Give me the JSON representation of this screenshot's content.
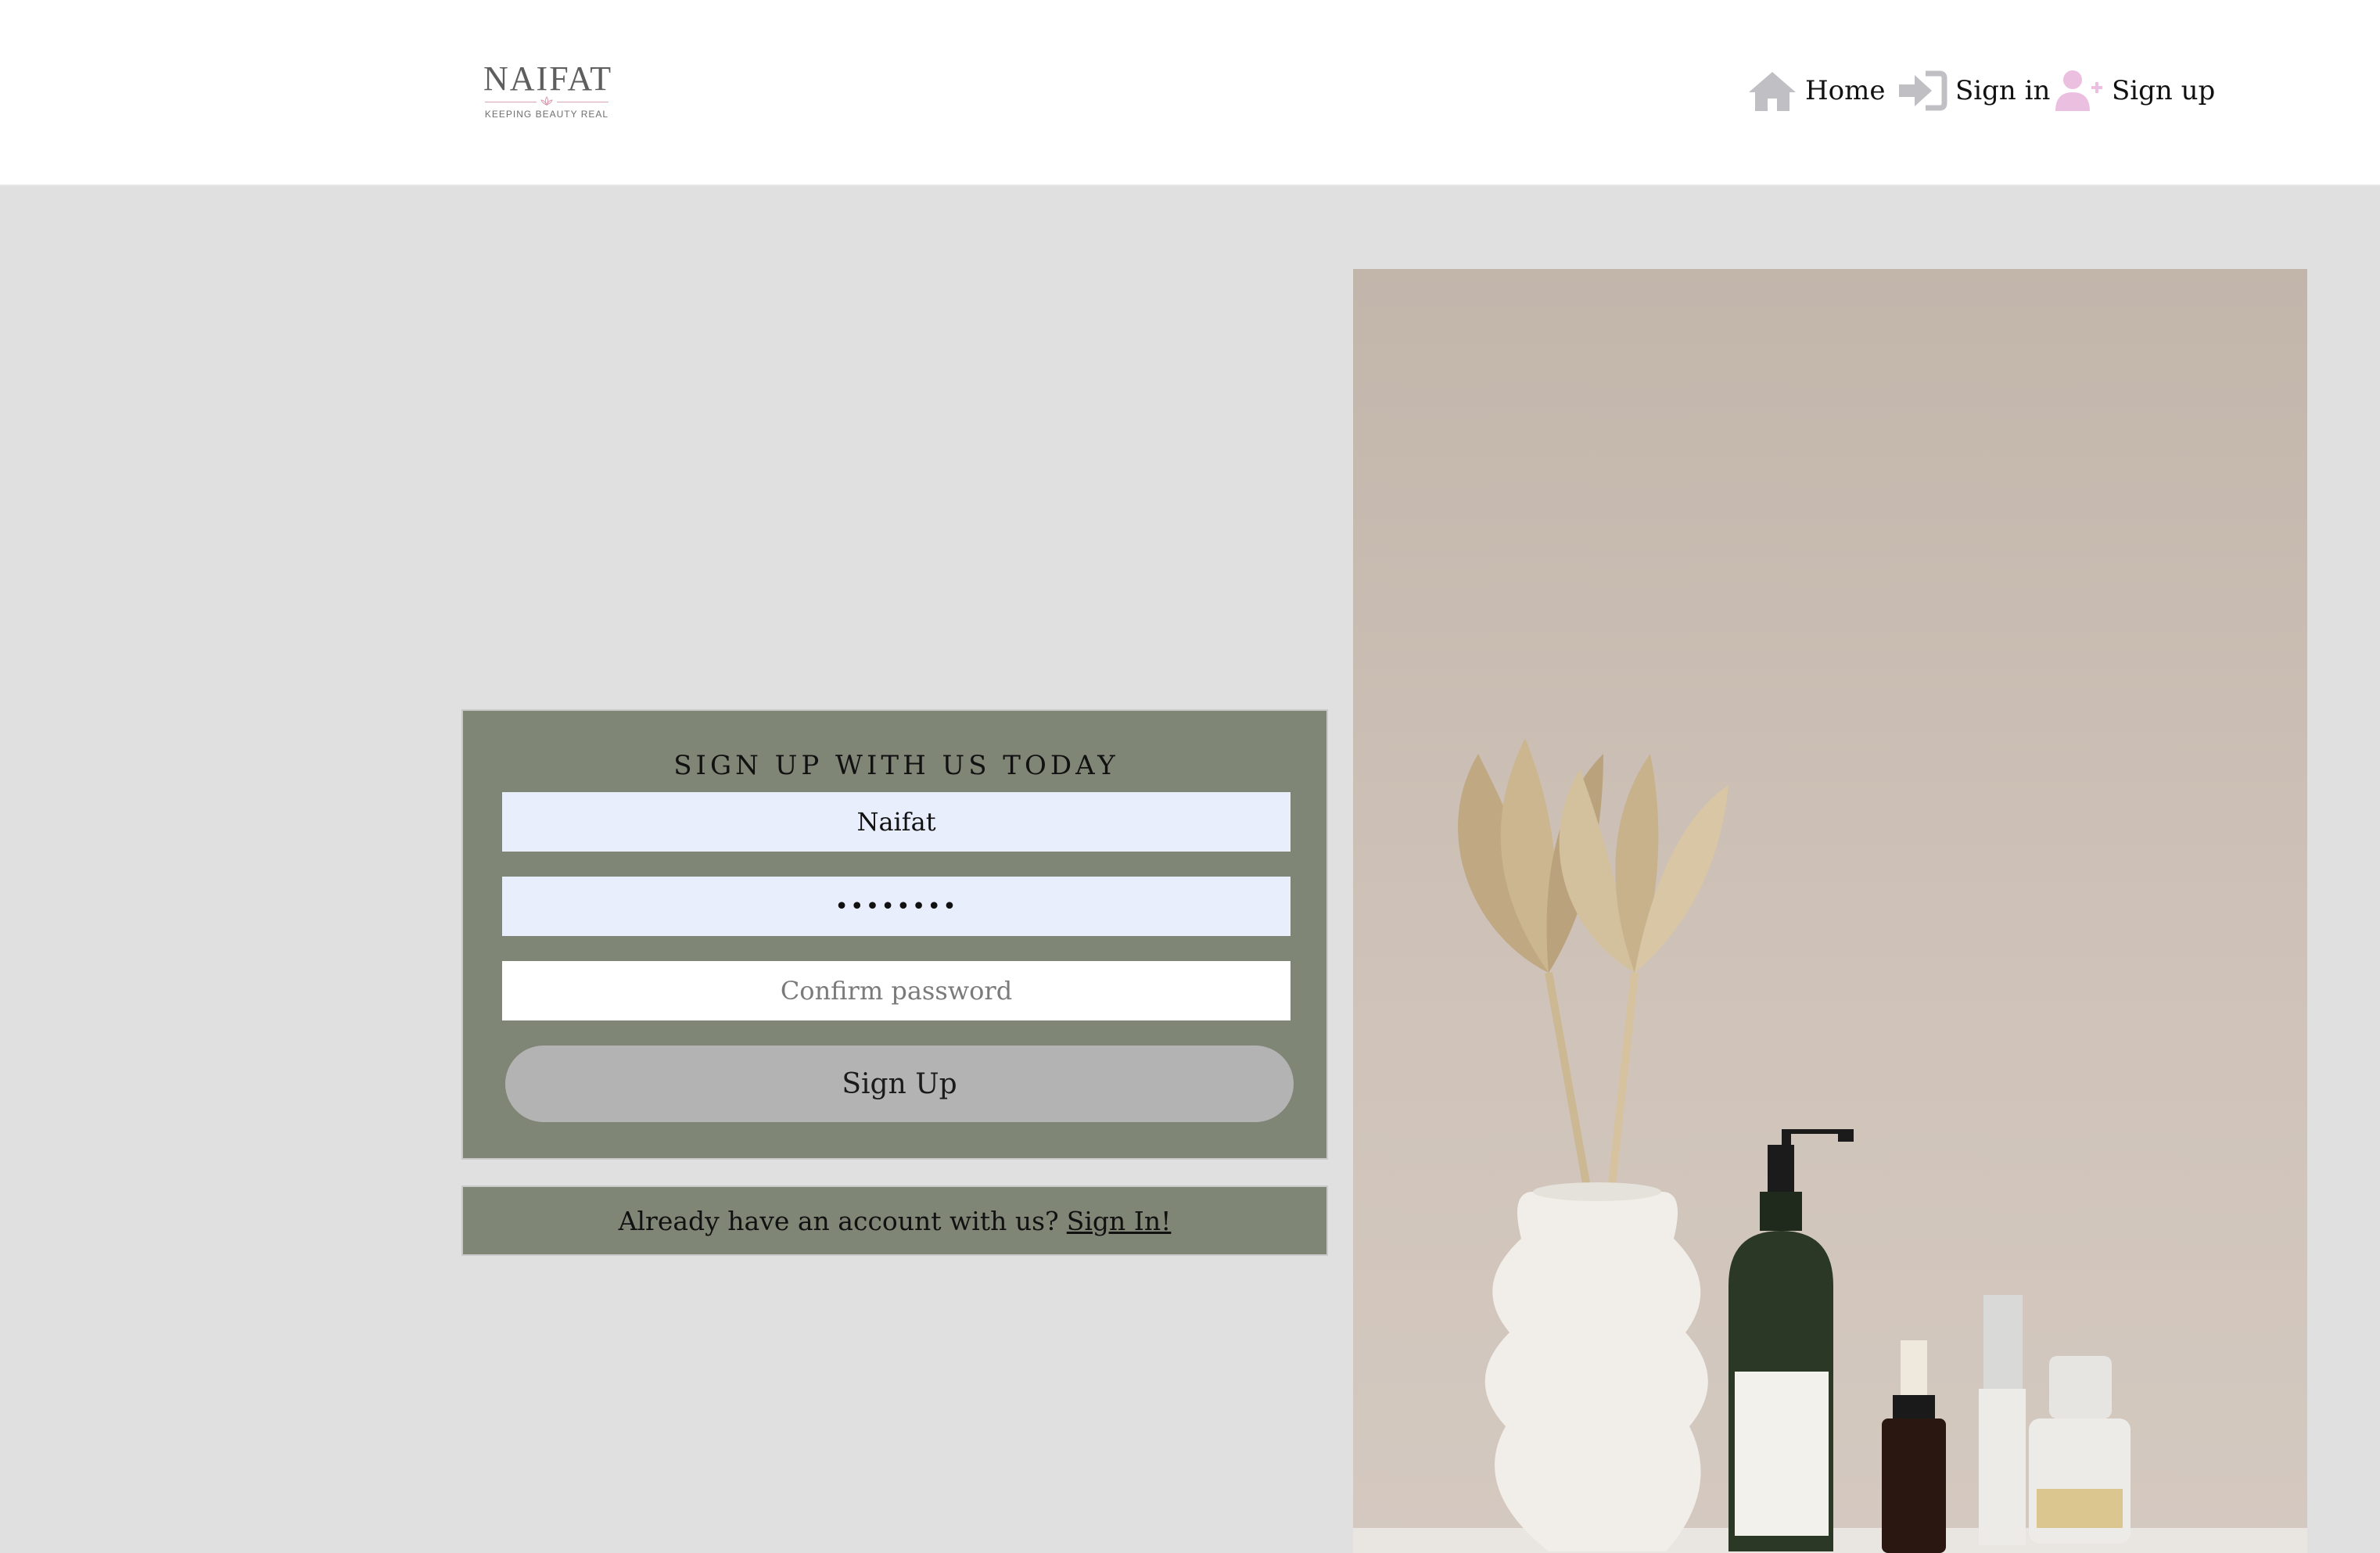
{
  "header": {
    "logo": {
      "name": "NAIFAT",
      "tagline": "KEEPING BEAUTY REAL"
    },
    "nav": [
      {
        "label": "Home",
        "icon": "home-icon",
        "icon_color": "#c0bfc3"
      },
      {
        "label": "Sign in",
        "icon": "sign-in-icon",
        "icon_color": "#c0bfc3"
      },
      {
        "label": "Sign up",
        "icon": "user-plus-icon",
        "icon_color": "#ebbfe0"
      }
    ]
  },
  "form": {
    "title": "SIGN UP WITH US TODAY",
    "username_value": "Naifat",
    "password_value": "••••••••",
    "confirm_placeholder": "Confirm password",
    "submit_label": "Sign Up"
  },
  "signin_prompt": {
    "text": "Already have an account with us?",
    "link_label": "Sign In!"
  },
  "colors": {
    "page_bg": "#e0e0e0",
    "card_bg": "#808676",
    "field_autofill_bg": "#e8eefb",
    "button_bg": "#b3b3b3"
  }
}
